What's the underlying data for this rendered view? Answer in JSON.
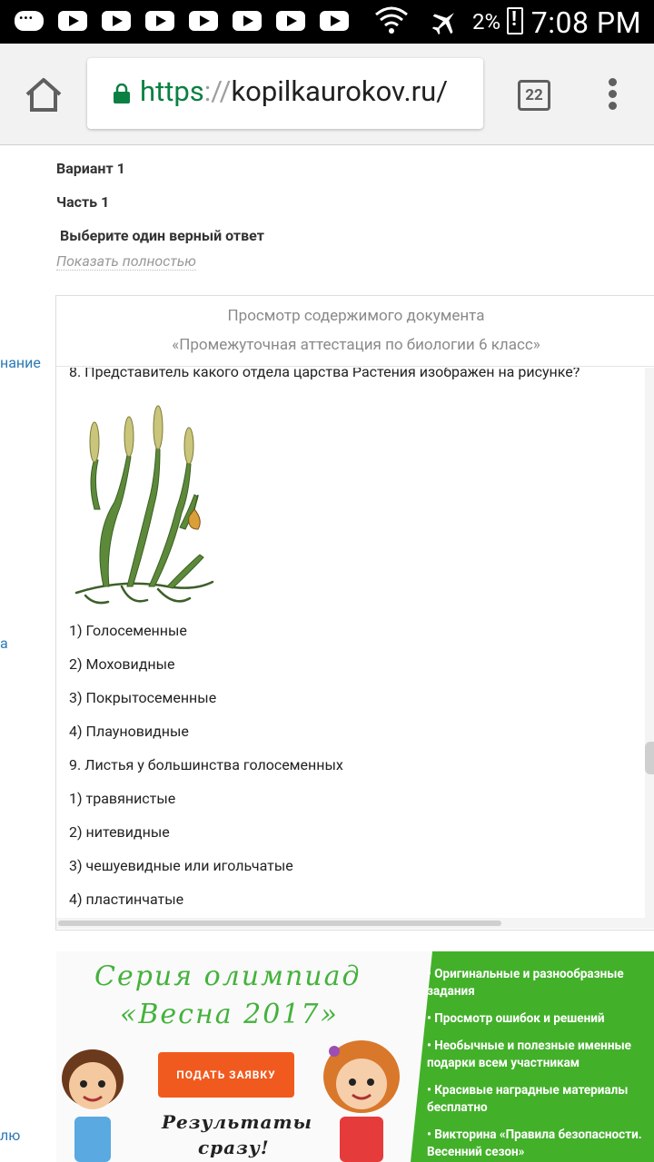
{
  "status_bar": {
    "time": "7:08 PM",
    "battery": "2%",
    "icons": [
      "chat-icon",
      "youtube-icon",
      "wifi-icon",
      "airplane-icon",
      "battery-icon"
    ]
  },
  "browser": {
    "url_scheme": "https",
    "url_sep": "://",
    "url_host": "kopilkaurokov.ru/",
    "tab_count": "22"
  },
  "page": {
    "variant": "Вариант 1",
    "part": "Часть 1",
    "instruction": "Выберите один верный ответ",
    "show_more": "Показать полностью",
    "side_links": [
      "нание",
      "а",
      "лю"
    ]
  },
  "viewer": {
    "title_line1": "Просмотр содержимого документа",
    "title_line2": "«Промежуточная аттестация по биологии 6 класс»",
    "lines": [
      "8. Представитель какого отдела царства Растения изображен на рисунке?",
      "1) Голосеменные",
      "2) Моховидные",
      "3) Покрытосеменные",
      "4) Плауновидные",
      "9. Листья у большинства голосеменных",
      "1) травянистые",
      "2) нитевидные",
      "3) чешуевидные или игольчатые",
      "4) пластинчатые"
    ]
  },
  "banner": {
    "title_line1": "Серия олимпиад",
    "title_line2": "«Весна 2017»",
    "cta": "ПОДАТЬ ЗАЯВКУ",
    "results_line1": "Результаты",
    "results_line2": "сразу!",
    "features": [
      "Оригинальные и разнообразные задания",
      "Просмотр ошибок и решений",
      "Необычные и полезные именные подарки всем участникам",
      "Красивые наградные материалы бесплатно",
      "Викторина «Правила безопасности. Весенний сезон»"
    ],
    "colors": {
      "green": "#43b02a",
      "orange": "#f15a1e"
    }
  }
}
